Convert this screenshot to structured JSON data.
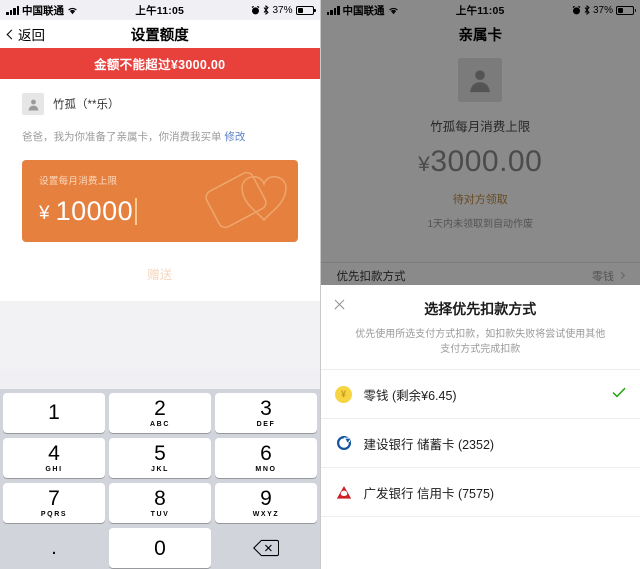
{
  "left": {
    "status_bar": {
      "carrier": "中国联通",
      "time": "上午11:05",
      "battery_percent": "37%",
      "signal_icon": "signal-bars-icon",
      "wifi_icon": "wifi-icon",
      "alarm_icon": "alarm-clock-icon",
      "bluetooth_icon": "bluetooth-icon",
      "battery_icon": "battery-icon"
    },
    "nav": {
      "back_label": "返回",
      "title": "设置额度",
      "back_icon": "chevron-left-icon"
    },
    "banner": "金额不能超过¥3000.00",
    "receiver": {
      "name": "竹孤（**乐）",
      "avatar_icon": "person-avatar-icon"
    },
    "wish": {
      "text": "爸爸，我为你准备了亲属卡，你消费我买单",
      "edit_label": "修改"
    },
    "amount_card": {
      "label": "设置每月消费上限",
      "currency": "¥",
      "value": "10000",
      "deco_icon": "card-heart-icon",
      "bg_color": "#e5803f"
    },
    "gift_button": "赠送",
    "keypad": {
      "keys": [
        {
          "num": "1",
          "sub": ""
        },
        {
          "num": "2",
          "sub": "ABC"
        },
        {
          "num": "3",
          "sub": "DEF"
        },
        {
          "num": "4",
          "sub": "GHI"
        },
        {
          "num": "5",
          "sub": "JKL"
        },
        {
          "num": "6",
          "sub": "MNO"
        },
        {
          "num": "7",
          "sub": "PQRS"
        },
        {
          "num": "8",
          "sub": "TUV"
        },
        {
          "num": "9",
          "sub": "WXYZ"
        },
        {
          "num": ".",
          "sub": ""
        },
        {
          "num": "0",
          "sub": ""
        }
      ],
      "backspace_icon": "backspace-icon"
    }
  },
  "right": {
    "status_bar": {
      "carrier": "中国联通",
      "time": "上午11:05",
      "battery_percent": "37%"
    },
    "nav": {
      "title": "亲属卡"
    },
    "hero": {
      "avatar_icon": "person-avatar-icon",
      "name_label": "竹孤每月消费上限",
      "currency": "¥",
      "amount": "3000.00",
      "status": "待对方领取",
      "note": "1天内未领取到自动作废"
    },
    "deduct_row": {
      "label": "优先扣款方式",
      "value": "零钱",
      "arrow_icon": "chevron-right-icon"
    },
    "sheet": {
      "close_icon": "close-icon",
      "title": "选择优先扣款方式",
      "subtitle": "优先使用所选支付方式扣款，如扣款失败将尝试使用其他支付方式完成扣款",
      "options": [
        {
          "label": "零钱 (剩余¥6.45)",
          "icon": "wallet-coin-icon",
          "selected": true,
          "color": "#f6d442"
        },
        {
          "label": "建设银行 储蓄卡 (2352)",
          "icon": "ccb-bank-icon",
          "selected": false,
          "color": "#12559e"
        },
        {
          "label": "广发银行 信用卡 (7575)",
          "icon": "cgb-bank-icon",
          "selected": false,
          "color": "#cf2029"
        }
      ],
      "check_icon": "check-icon",
      "check_color": "#2aa514"
    }
  }
}
